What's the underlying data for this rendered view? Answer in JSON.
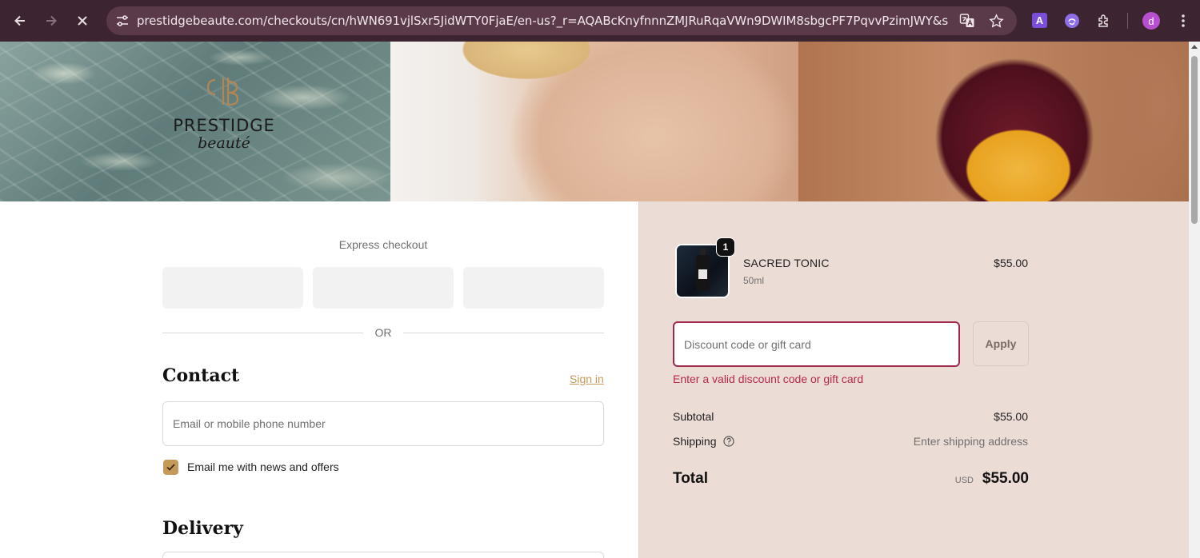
{
  "browser": {
    "url": "prestidgebeaute.com/checkouts/cn/hWN691vjlSxr5JidWTY0FjaE/en-us?_r=AQABcKnyfnnnZMJRuRqaVWn9DWIM8sbgcPF7PqvvPzimJWY&skip_shop...",
    "profile_initial": "d",
    "extension_a_label": "A"
  },
  "brand": {
    "name": "PRESTIDGE",
    "sub": "beauté"
  },
  "checkout": {
    "express_label": "Express checkout",
    "or_label": "OR",
    "contact_heading": "Contact",
    "sign_in": "Sign in",
    "email_placeholder": "Email or mobile phone number",
    "newsletter_label": "Email me with news and offers",
    "newsletter_checked": true,
    "delivery_heading": "Delivery"
  },
  "summary": {
    "item": {
      "quantity": "1",
      "name": "SACRED TONIC",
      "variant": "50ml",
      "price": "$55.00"
    },
    "discount_placeholder": "Discount code or gift card",
    "apply_label": "Apply",
    "discount_error": "Enter a valid discount code or gift card",
    "subtotal_label": "Subtotal",
    "subtotal_value": "$55.00",
    "shipping_label": "Shipping",
    "shipping_value": "Enter shipping address",
    "total_label": "Total",
    "currency": "USD",
    "total_value": "$55.00"
  },
  "colors": {
    "accent": "#c59a59",
    "error": "#b4294d",
    "summary_bg": "#ecdcd6",
    "chrome_bg": "#3c2430"
  }
}
